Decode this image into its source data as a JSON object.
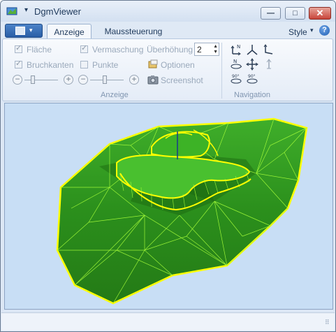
{
  "window": {
    "title": "DgmViewer",
    "quick_access_arrow": "▾"
  },
  "controls": {
    "minimize": "—",
    "maximize": "□",
    "close": "✕"
  },
  "tabs": [
    {
      "label": "Anzeige",
      "active": true
    },
    {
      "label": "Maussteuerung",
      "active": false
    }
  ],
  "style_menu": {
    "label": "Style",
    "arrow": "▾"
  },
  "help": {
    "symbol": "?"
  },
  "anzeige": {
    "flaeche": "Fläche",
    "vermaschung": "Vermaschung",
    "ueberhoehung_label": "Überhöhung",
    "ueberhoehung_value": "2",
    "bruchkanten": "Bruchkanten",
    "punkte": "Punkte",
    "optionen": "Optionen",
    "screenshot": "Screenshot",
    "group_label": "Anzeige"
  },
  "navigation": {
    "group_label": "Navigation"
  },
  "colors": {
    "terrain": "#2e9a1f",
    "mesh": "#b5ff4a",
    "breakline": "#ffff00",
    "background": "#c8def5"
  }
}
